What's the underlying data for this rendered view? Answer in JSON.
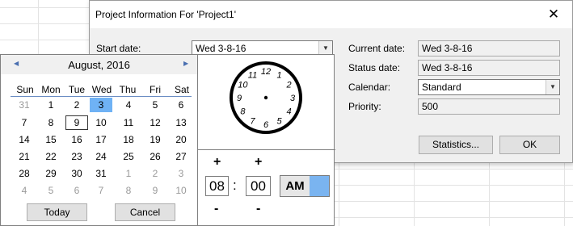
{
  "dialog": {
    "title": "Project Information For 'Project1'",
    "close_glyph": "✕",
    "start_date_label": "Start date:",
    "start_date_value": "Wed 3-8-16",
    "current_date_label": "Current date:",
    "current_date_value": "Wed 3-8-16",
    "status_date_label": "Status date:",
    "status_date_value": "Wed 3-8-16",
    "calendar_label": "Calendar:",
    "calendar_value": "Standard",
    "priority_label": "Priority:",
    "priority_value": "500",
    "statistics_button": "Statistics...",
    "ok_button": "OK"
  },
  "datepicker": {
    "month_title": "August, 2016",
    "prev_arrow": "◀",
    "next_arrow": "▶",
    "weekdays": [
      "Sun",
      "Mon",
      "Tue",
      "Wed",
      "Thu",
      "Fri",
      "Sat"
    ],
    "weeks": [
      [
        "31",
        "1",
        "2",
        "3",
        "4",
        "5",
        "6"
      ],
      [
        "7",
        "8",
        "9",
        "10",
        "11",
        "12",
        "13"
      ],
      [
        "14",
        "15",
        "16",
        "17",
        "18",
        "19",
        "20"
      ],
      [
        "21",
        "22",
        "23",
        "24",
        "25",
        "26",
        "27"
      ],
      [
        "28",
        "29",
        "30",
        "31",
        "1",
        "2",
        "3"
      ],
      [
        "4",
        "5",
        "6",
        "7",
        "8",
        "9",
        "10"
      ]
    ],
    "selected_day": "3",
    "today_day": "9",
    "today_button": "Today",
    "cancel_button": "Cancel"
  },
  "time": {
    "clock_numbers": [
      "12",
      "1",
      "2",
      "3",
      "4",
      "5",
      "6",
      "7",
      "8",
      "9",
      "10",
      "11"
    ],
    "plus": "+",
    "minus": "-",
    "hour": "08",
    "separator": ":",
    "minute": "00",
    "ampm": "AM"
  },
  "colors": {
    "selection": "#6fb2f5",
    "ampm_highlight": "#7ab4f0"
  }
}
